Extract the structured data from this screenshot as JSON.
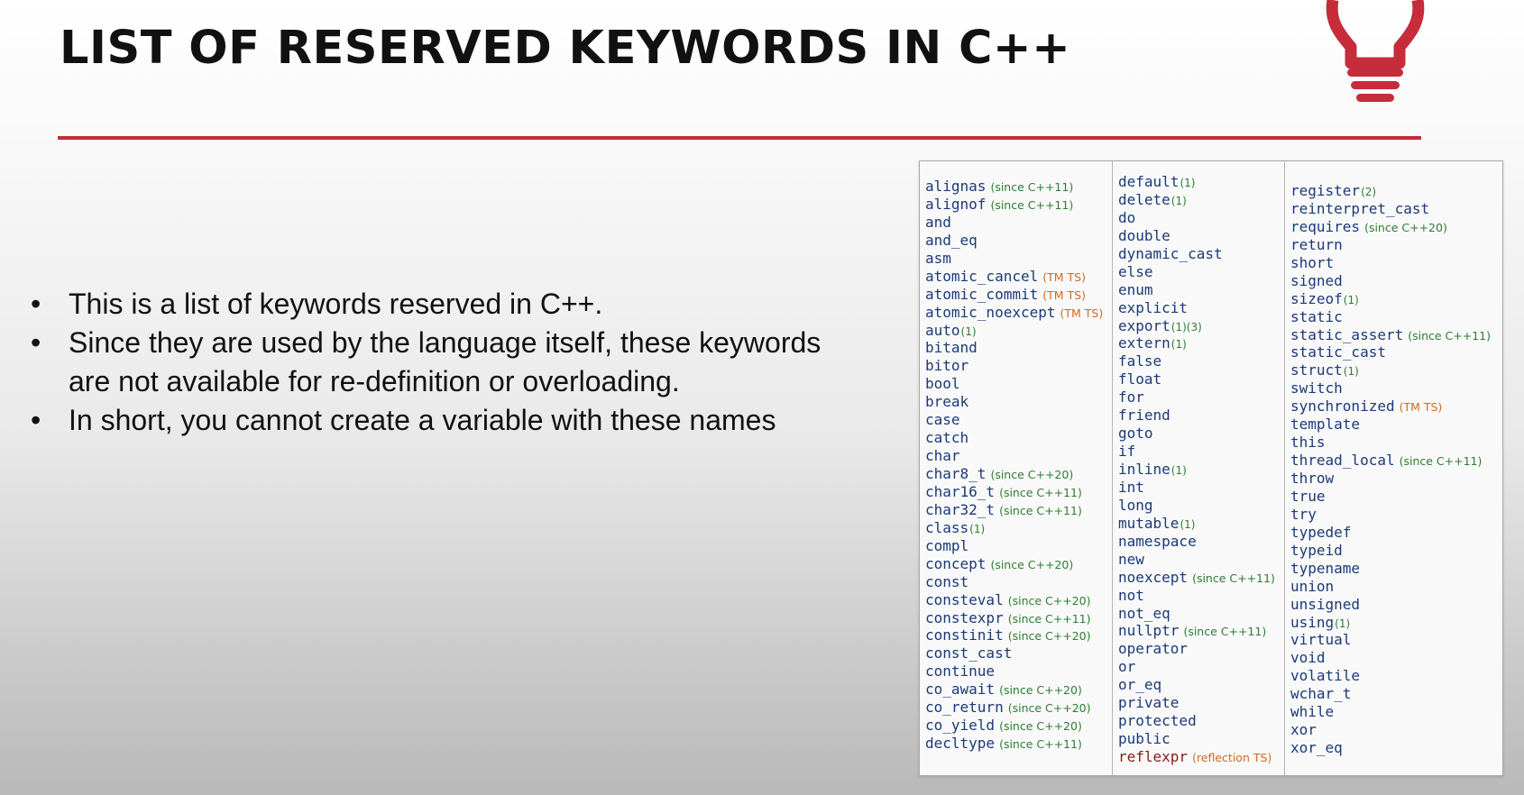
{
  "title": "LIST OF RESERVED KEYWORDS IN C++",
  "colors": {
    "accent": "#c62c3a",
    "keyword": "#1b3a78",
    "since": "#2e7d32",
    "ts": "#d2691e",
    "reflection": "#8b1a1a"
  },
  "icon": "lightbulb-icon",
  "bullets": [
    "This is a list of keywords reserved in C++.",
    "Since they are used by the language itself, these keywords are not available for re-definition or overloading.",
    "In short, you cannot create a variable with these names"
  ],
  "keywords": {
    "col1": [
      {
        "kw": "alignas",
        "note": "(since C++11)",
        "nt": "green"
      },
      {
        "kw": "alignof",
        "note": "(since C++11)",
        "nt": "green"
      },
      {
        "kw": "and"
      },
      {
        "kw": "and_eq"
      },
      {
        "kw": "asm"
      },
      {
        "kw": "atomic_cancel",
        "note": "(TM TS)",
        "nt": "orange"
      },
      {
        "kw": "atomic_commit",
        "note": "(TM TS)",
        "nt": "orange"
      },
      {
        "kw": "atomic_noexcept",
        "note": "(TM TS)",
        "nt": "orange"
      },
      {
        "kw": "auto",
        "note": "(1)",
        "nt": "sup"
      },
      {
        "kw": "bitand"
      },
      {
        "kw": "bitor"
      },
      {
        "kw": "bool"
      },
      {
        "kw": "break"
      },
      {
        "kw": "case"
      },
      {
        "kw": "catch"
      },
      {
        "kw": "char"
      },
      {
        "kw": "char8_t",
        "note": "(since C++20)",
        "nt": "green"
      },
      {
        "kw": "char16_t",
        "note": "(since C++11)",
        "nt": "green"
      },
      {
        "kw": "char32_t",
        "note": "(since C++11)",
        "nt": "green"
      },
      {
        "kw": "class",
        "note": "(1)",
        "nt": "sup"
      },
      {
        "kw": "compl"
      },
      {
        "kw": "concept",
        "note": "(since C++20)",
        "nt": "green"
      },
      {
        "kw": "const"
      },
      {
        "kw": "consteval",
        "note": "(since C++20)",
        "nt": "green"
      },
      {
        "kw": "constexpr",
        "note": "(since C++11)",
        "nt": "green"
      },
      {
        "kw": "constinit",
        "note": "(since C++20)",
        "nt": "green"
      },
      {
        "kw": "const_cast"
      },
      {
        "kw": "continue"
      },
      {
        "kw": "co_await",
        "note": "(since C++20)",
        "nt": "green"
      },
      {
        "kw": "co_return",
        "note": "(since C++20)",
        "nt": "green"
      },
      {
        "kw": "co_yield",
        "note": "(since C++20)",
        "nt": "green"
      },
      {
        "kw": "decltype",
        "note": "(since C++11)",
        "nt": "green"
      }
    ],
    "col2": [
      {
        "kw": "default",
        "note": "(1)",
        "nt": "sup"
      },
      {
        "kw": "delete",
        "note": "(1)",
        "nt": "sup"
      },
      {
        "kw": "do"
      },
      {
        "kw": "double"
      },
      {
        "kw": "dynamic_cast"
      },
      {
        "kw": "else"
      },
      {
        "kw": "enum"
      },
      {
        "kw": "explicit"
      },
      {
        "kw": "export",
        "note": "(1)(3)",
        "nt": "sup"
      },
      {
        "kw": "extern",
        "note": "(1)",
        "nt": "sup"
      },
      {
        "kw": "false"
      },
      {
        "kw": "float"
      },
      {
        "kw": "for"
      },
      {
        "kw": "friend"
      },
      {
        "kw": "goto"
      },
      {
        "kw": "if"
      },
      {
        "kw": "inline",
        "note": "(1)",
        "nt": "sup"
      },
      {
        "kw": "int"
      },
      {
        "kw": "long"
      },
      {
        "kw": "mutable",
        "note": "(1)",
        "nt": "sup"
      },
      {
        "kw": "namespace"
      },
      {
        "kw": "new"
      },
      {
        "kw": "noexcept",
        "note": "(since C++11)",
        "nt": "green"
      },
      {
        "kw": "not"
      },
      {
        "kw": "not_eq"
      },
      {
        "kw": "nullptr",
        "note": "(since C++11)",
        "nt": "green"
      },
      {
        "kw": "operator"
      },
      {
        "kw": "or"
      },
      {
        "kw": "or_eq"
      },
      {
        "kw": "private"
      },
      {
        "kw": "protected"
      },
      {
        "kw": "public"
      },
      {
        "kw": "reflexpr",
        "note": "(reflection TS)",
        "nt": "orange",
        "red": true
      }
    ],
    "col3": [
      {
        "kw": "register",
        "note": "(2)",
        "nt": "sup"
      },
      {
        "kw": "reinterpret_cast"
      },
      {
        "kw": "requires",
        "note": "(since C++20)",
        "nt": "green"
      },
      {
        "kw": "return"
      },
      {
        "kw": "short"
      },
      {
        "kw": "signed"
      },
      {
        "kw": "sizeof",
        "note": "(1)",
        "nt": "sup"
      },
      {
        "kw": "static"
      },
      {
        "kw": "static_assert",
        "note": "(since C++11)",
        "nt": "green"
      },
      {
        "kw": "static_cast"
      },
      {
        "kw": "struct",
        "note": "(1)",
        "nt": "sup"
      },
      {
        "kw": "switch"
      },
      {
        "kw": "synchronized",
        "note": "(TM TS)",
        "nt": "orange"
      },
      {
        "kw": "template"
      },
      {
        "kw": "this"
      },
      {
        "kw": "thread_local",
        "note": "(since C++11)",
        "nt": "green"
      },
      {
        "kw": "throw"
      },
      {
        "kw": "true"
      },
      {
        "kw": "try"
      },
      {
        "kw": "typedef"
      },
      {
        "kw": "typeid"
      },
      {
        "kw": "typename"
      },
      {
        "kw": "union"
      },
      {
        "kw": "unsigned"
      },
      {
        "kw": "using",
        "note": "(1)",
        "nt": "sup"
      },
      {
        "kw": "virtual"
      },
      {
        "kw": "void"
      },
      {
        "kw": "volatile"
      },
      {
        "kw": "wchar_t"
      },
      {
        "kw": "while"
      },
      {
        "kw": "xor"
      },
      {
        "kw": "xor_eq"
      }
    ]
  }
}
